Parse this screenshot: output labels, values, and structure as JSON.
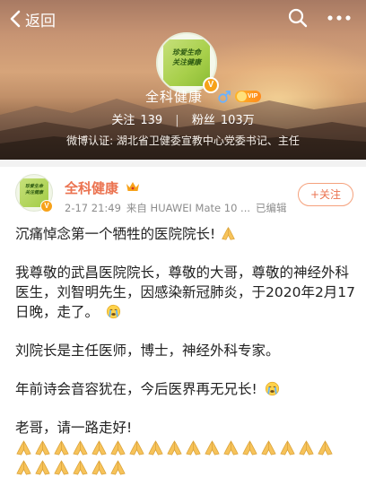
{
  "topbar": {
    "back_label": "返回",
    "back_icon": "chevron-left-icon",
    "search_icon": "search-icon",
    "more_icon": "more-horizontal-icon"
  },
  "profile": {
    "avatar_text_line1": "珍爱生命",
    "avatar_text_line2": "关注健康",
    "verified_mark": "V",
    "name": "全科健康",
    "gender_icon": "male-icon",
    "vip_label": "VIP",
    "following_label": "关注",
    "following_count": "139",
    "followers_label": "粉丝",
    "followers_count": "103万",
    "verification": "微博认证: 湖北省卫健委宣教中心党委书记、主任"
  },
  "post": {
    "author": "全科健康",
    "verified_mark": "V",
    "time": "2-17 21:49",
    "source": "来自 HUAWEI Mate 10 ...",
    "edited": "已编辑",
    "follow_label": "+关注",
    "para1": "沉痛悼念第一个牺牲的医院院长!",
    "para2": "我尊敬的武昌医院院长，尊敬的大哥，尊敬的神经外科医生，刘智明先生，因感染新冠肺炎，于2020年2月17日晚，走了。",
    "para3": "刘院长是主任医师，博士，神经外科专家。",
    "para4": "年前诗会音容犹在，今后医界再无兄长!",
    "para5": "老哥，请一路走好!",
    "pray_emoji_count": 23
  },
  "colors": {
    "accent": "#eb7350",
    "verify_badge": "#f7a21a",
    "meta_gray": "#8c8c8c"
  }
}
